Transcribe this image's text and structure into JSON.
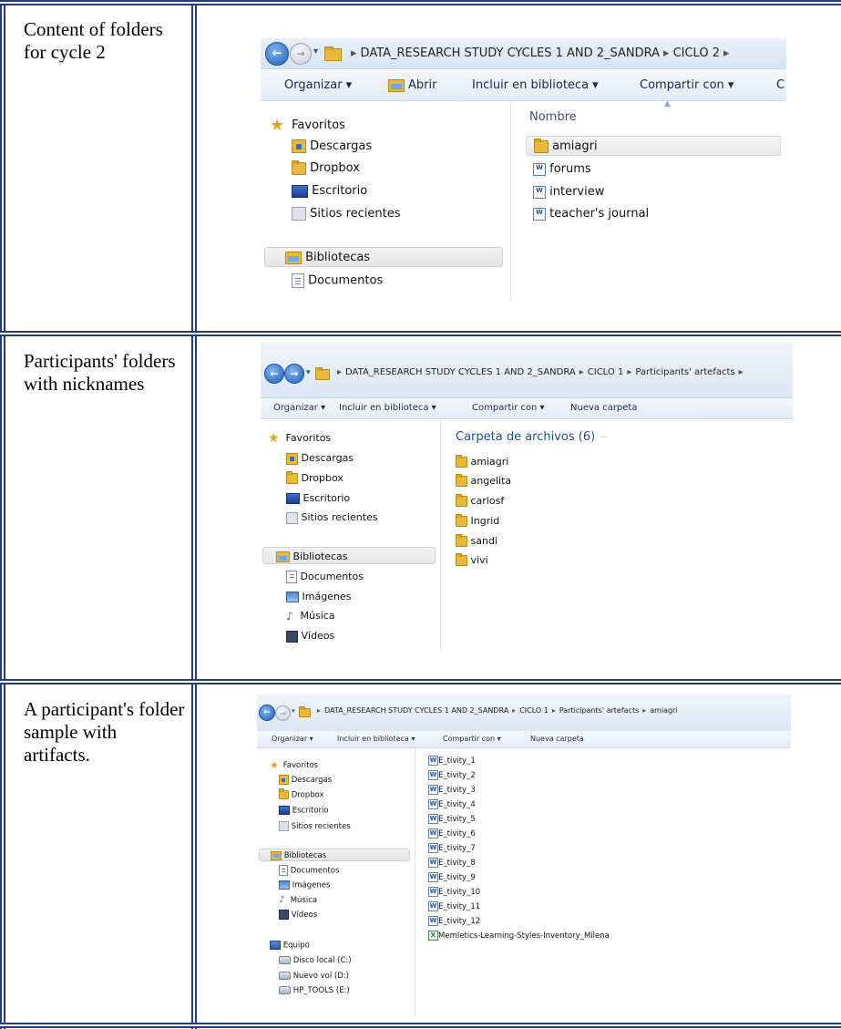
{
  "rows": [
    {
      "label": "Content of folders for cycle 2",
      "explorer": {
        "breadcrumbs": [
          "DATA_RESEARCH STUDY CYCLES 1 AND 2_SANDRA",
          "CICLO 2"
        ],
        "toolbar": [
          "Organizar ▾",
          "Abrir",
          "Incluir en biblioteca ▾",
          "Compartir con ▾",
          "C"
        ],
        "column_header": "Nombre",
        "nav": [
          "Favoritos",
          "Descargas",
          "Dropbox",
          "Escritorio",
          "Sitios recientes",
          "Bibliotecas",
          "Documentos"
        ],
        "files": [
          "amiagri",
          "forums",
          "interview",
          "teacher's journal"
        ]
      }
    },
    {
      "label": "Participants' folders with nicknames",
      "explorer": {
        "breadcrumbs": [
          "DATA_RESEARCH STUDY CYCLES 1 AND 2_SANDRA",
          "CICLO 1",
          "Participants' artefacts"
        ],
        "toolbar": [
          "Organizar ▾",
          "Incluir en biblioteca ▾",
          "Compartir con ▾",
          "Nueva carpeta"
        ],
        "group_header": "Carpeta de archivos (6)",
        "nav": [
          "Favoritos",
          "Descargas",
          "Dropbox",
          "Escritorio",
          "Sitios recientes",
          "Bibliotecas",
          "Documentos",
          "Imágenes",
          "Música",
          "Vídeos"
        ],
        "files": [
          "amiagri",
          "angelita",
          "carlosf",
          "Ingrid",
          "sandi",
          "vivi"
        ]
      }
    },
    {
      "label": "A participant's folder sample with artifacts.",
      "explorer": {
        "breadcrumbs": [
          "DATA_RESEARCH STUDY CYCLES 1 AND 2_SANDRA",
          "CICLO 1",
          "Participants' artefacts",
          "amiagri"
        ],
        "toolbar": [
          "Organizar ▾",
          "Incluir en biblioteca ▾",
          "Compartir con ▾",
          "Nueva carpeta"
        ],
        "nav": [
          "Favoritos",
          "Descargas",
          "Dropbox",
          "Escritorio",
          "Sitios recientes",
          "Bibliotecas",
          "Documentos",
          "Imágenes",
          "Música",
          "Vídeos",
          "Equipo",
          "Disco local (C:)",
          "Nuevo vol (D:)",
          "HP_TOOLS (E:)"
        ],
        "files": [
          "E_tivity_1",
          "E_tivity_2",
          "E_tivity_3",
          "E_tivity_4",
          "E_tivity_5",
          "E_tivity_6",
          "E_tivity_7",
          "E_tivity_8",
          "E_tivity_9",
          "E_tivity_10",
          "E_tivity_11",
          "E_tivity_12",
          "Memletics-Learning-Styles-Inventory_Milena"
        ]
      }
    }
  ]
}
